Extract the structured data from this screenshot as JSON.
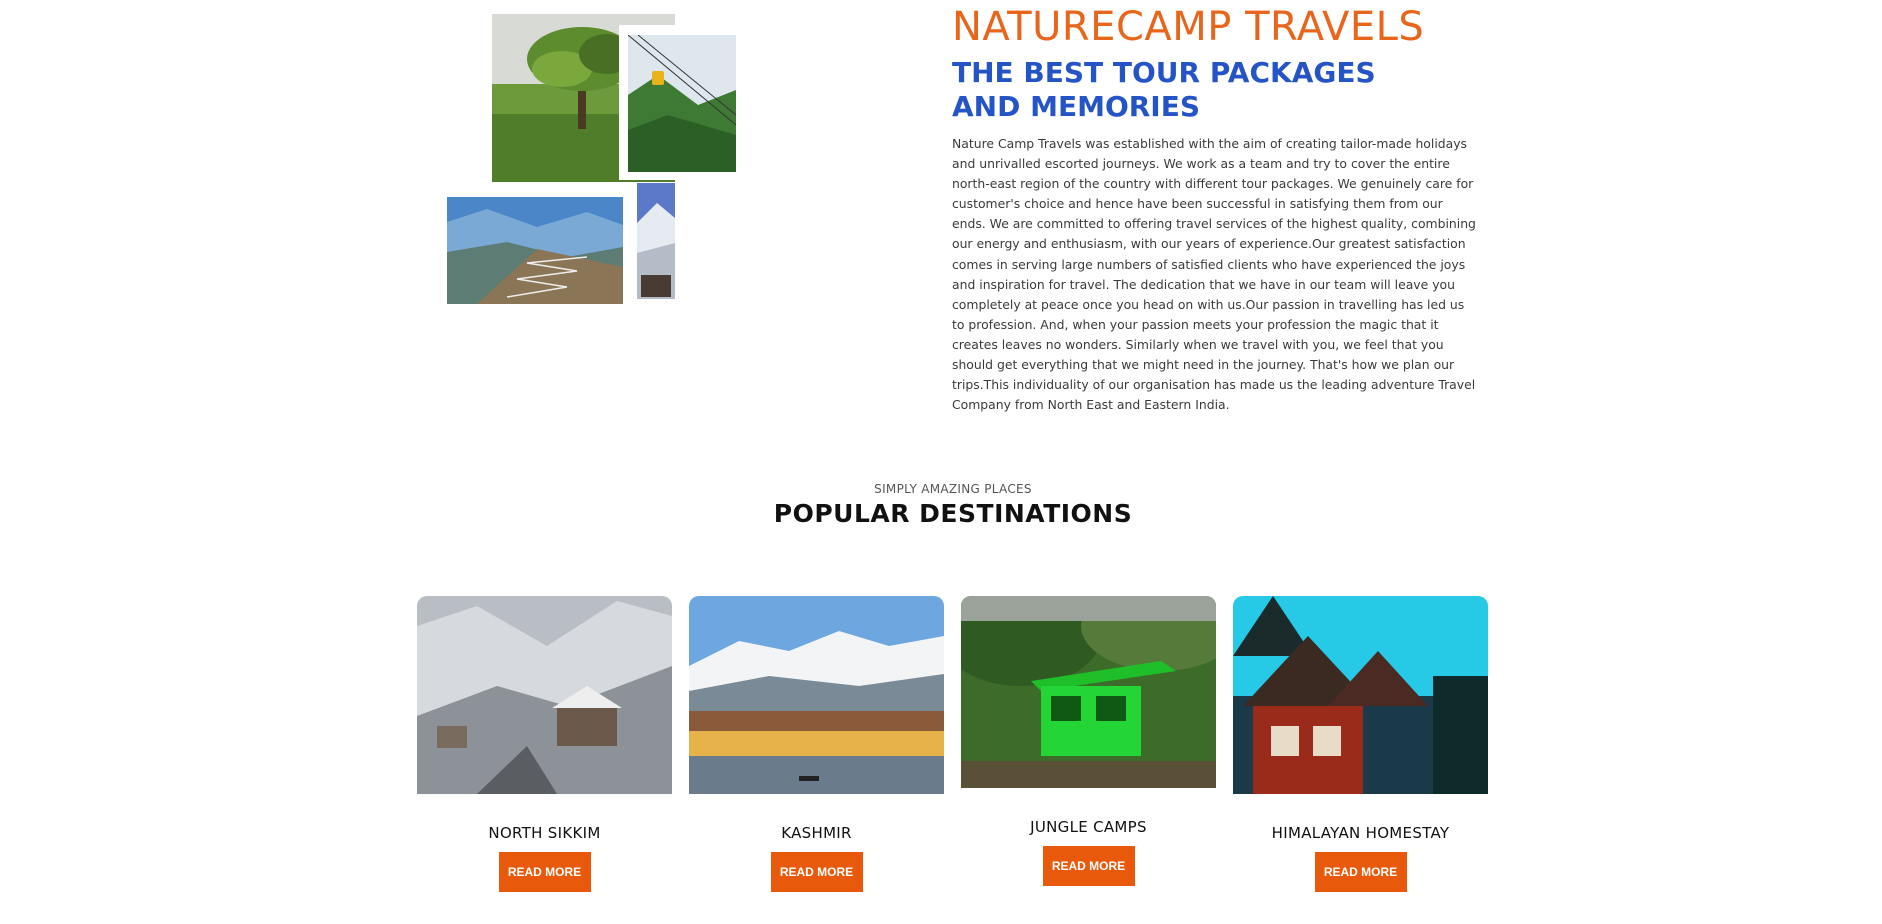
{
  "about": {
    "brand": "NATURECAMP TRAVELS",
    "tagline": "THE BEST TOUR PACKAGES AND MEMORIES",
    "body": "Nature Camp Travels was established with the aim of creating tailor-made holidays and unrivalled escorted journeys. We work as a team and try to cover the entire north-east region of the country with different tour packages. We genuinely care for customer's choice and hence have been successful in satisfying them from our ends. We are committed to offering travel services of the highest quality, combining our energy and enthusiasm, with our years of experience.Our greatest satisfaction comes in serving large numbers of satisfied clients who have experienced the joys and inspiration for travel. The dedication that we have in our team will leave you completely at peace once you head on with us.Our passion in travelling has led us to profession. And, when your passion meets your profession the magic that it creates leaves no wonders. Similarly when we travel with you, we feel that you should get everything that we might need in the journey. That's how we plan our trips.This individuality of our organisation has made us the leading adventure Travel Company from North East and Eastern India."
  },
  "destinations": {
    "kicker": "SIMPLY AMAZING PLACES",
    "heading": "POPULAR DESTINATIONS",
    "cards": [
      {
        "title": "NORTH SIKKIM",
        "button": "READ MORE"
      },
      {
        "title": "KASHMIR",
        "button": "READ MORE"
      },
      {
        "title": "JUNGLE CAMPS",
        "button": "READ MORE"
      },
      {
        "title": "HIMALAYAN HOMESTAY",
        "button": "READ MORE"
      }
    ]
  },
  "colors": {
    "brand_orange": "#e8661c",
    "tagline_blue": "#2554c7",
    "button_orange": "#e9590c"
  }
}
